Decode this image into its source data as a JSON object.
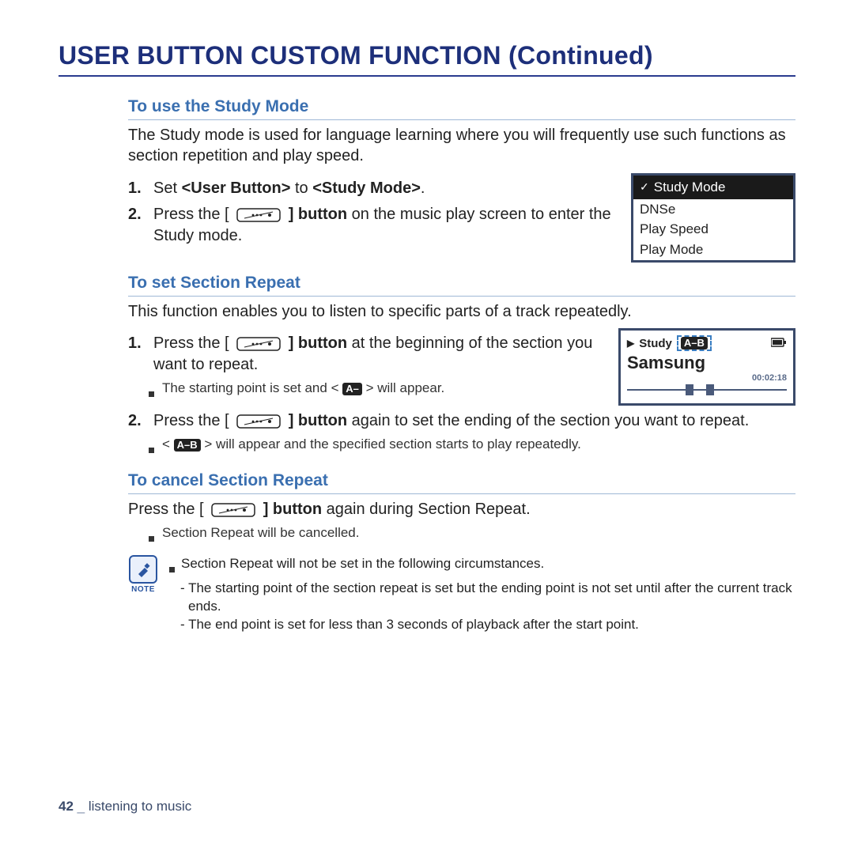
{
  "page_title": "USER BUTTON CUSTOM FUNCTION (Continued)",
  "sec1": {
    "heading": "To use the Study Mode",
    "intro": "The Study mode is used for language learning where you will frequently use such functions as section repetition and play speed.",
    "step1_pre": "Set ",
    "step1_bold1": "<User Button>",
    "step1_mid": " to ",
    "step1_bold2": "<Study Mode>",
    "step1_post": ".",
    "step2_pre": "Press the [ ",
    "step2_bold": " ] button",
    "step2_post": " on the music play screen to enter the Study mode."
  },
  "menu": {
    "selected": "Study Mode",
    "items": [
      "DNSe",
      "Play Speed",
      "Play Mode"
    ]
  },
  "sec2": {
    "heading": "To set Section Repeat",
    "intro": "This function enables you to listen to specific parts of a track repeatedly.",
    "step1_pre": "Press the [ ",
    "step1_bold": " ] button",
    "step1_post": " at the beginning of the section you want to repeat.",
    "sub1_pre": "The starting point is set and < ",
    "sub1_badge": "A–",
    "sub1_post": " > will appear.",
    "step2_pre": "Press the [ ",
    "step2_bold": " ] button",
    "step2_post": " again to set the ending of the section you want to repeat.",
    "sub2_pre": "< ",
    "sub2_badge": "A–B",
    "sub2_post": " > will appear and the specified section starts to play repeatedly."
  },
  "player": {
    "label": "Study",
    "ab_badge": "A–B",
    "track": "Samsung",
    "time": "00:02:18"
  },
  "sec3": {
    "heading": "To cancel Section Repeat",
    "line_pre": "Press the [ ",
    "line_bold": " ] button",
    "line_post": " again during Section Repeat.",
    "sub": "Section Repeat will be cancelled."
  },
  "note": {
    "label": "NOTE",
    "lead": "Section Repeat will not be set in the following circumstances.",
    "d1": "- The starting point of the section repeat is set but the ending point is not set until after the current track ends.",
    "d2": "- The end point is set for less than 3 seconds of playback after the start point."
  },
  "footer": {
    "page_no": "42",
    "sep": " _ ",
    "section": "listening to music"
  }
}
